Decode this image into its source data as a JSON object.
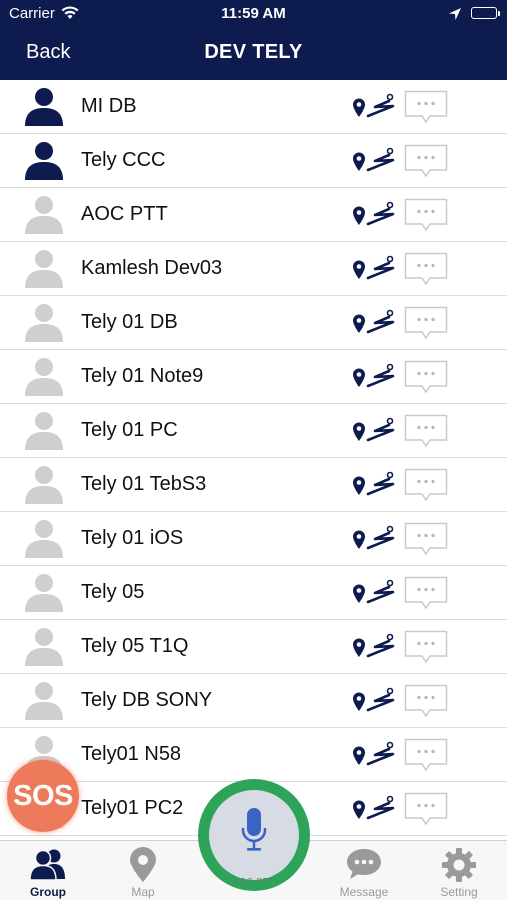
{
  "status_bar": {
    "carrier": "Carrier",
    "time": "11:59 AM"
  },
  "nav": {
    "back_label": "Back",
    "title": "DEV TELY"
  },
  "contacts": [
    {
      "name": "MI DB",
      "online": true
    },
    {
      "name": "Tely CCC",
      "online": true
    },
    {
      "name": "AOC PTT",
      "online": false
    },
    {
      "name": "Kamlesh Dev03",
      "online": false
    },
    {
      "name": "Tely 01 DB",
      "online": false
    },
    {
      "name": "Tely 01 Note9",
      "online": false
    },
    {
      "name": "Tely 01 PC",
      "online": false
    },
    {
      "name": "Tely 01 TebS3",
      "online": false
    },
    {
      "name": "Tely 01 iOS",
      "online": false
    },
    {
      "name": "Tely 05",
      "online": false
    },
    {
      "name": "Tely 05 T1Q",
      "online": false
    },
    {
      "name": "Tely DB SONY",
      "online": false
    },
    {
      "name": "Tely01 N58",
      "online": false
    },
    {
      "name": "Tely01 PC2",
      "online": false
    }
  ],
  "sos": {
    "label": "SOS"
  },
  "ptt": {
    "label": "AOC PTT"
  },
  "tabs": [
    {
      "label": "Group",
      "icon": "group-icon",
      "active": true
    },
    {
      "label": "Map",
      "icon": "map-pin-icon",
      "active": false
    },
    {
      "label": "Message",
      "icon": "message-icon",
      "active": false
    },
    {
      "label": "Setting",
      "icon": "gear-icon",
      "active": false
    }
  ],
  "colors": {
    "nav_bar": "#0d1b4f",
    "online_avatar": "#0d1b4f",
    "offline_avatar": "#cfcfcf",
    "ptt_ring": "#2ea45a",
    "sos": "#ee7a5c",
    "mic": "#3a63c4"
  }
}
